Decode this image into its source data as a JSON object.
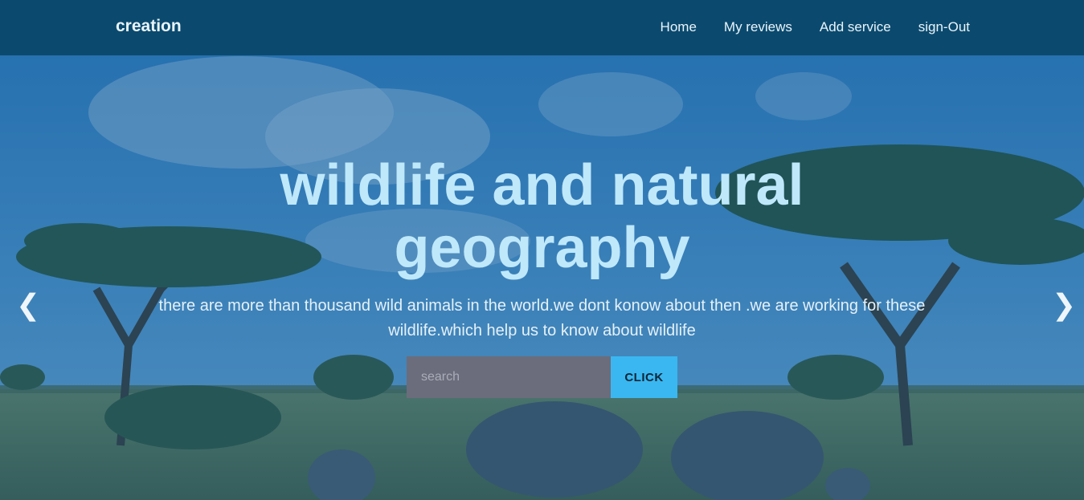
{
  "navbar": {
    "brand": "creation",
    "links": [
      "Home",
      "My reviews",
      "Add service",
      "sign-Out"
    ]
  },
  "hero": {
    "title_line1": "wildlife and natural",
    "title_line2": "geography",
    "subtitle": "there are more than thousand wild animals in the world.we dont konow about then .we are working for these wildlife.which help us to know about wildlife",
    "search": {
      "placeholder": "search",
      "value": ""
    },
    "button_label": "CLICK",
    "prev_arrow": "❮",
    "next_arrow": "❯"
  }
}
